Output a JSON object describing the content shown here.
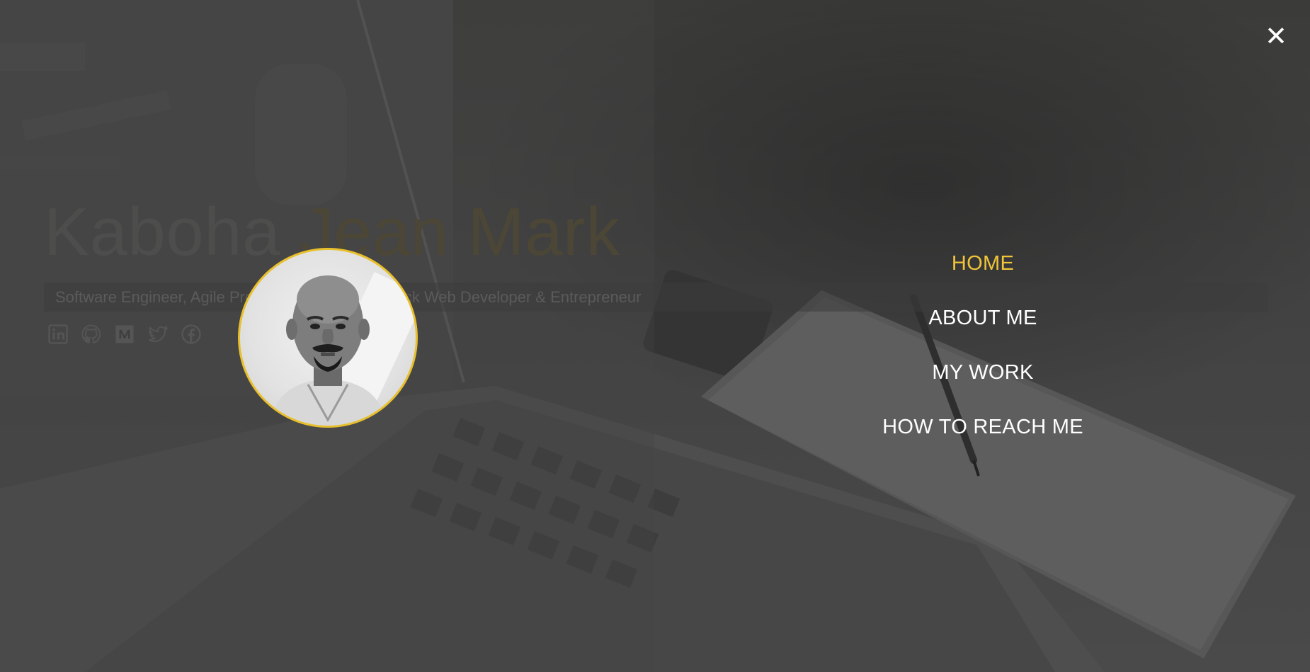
{
  "hero": {
    "first_name": "Kaboha",
    "last_name": "Jean Mark",
    "subtitle": "Software Engineer, Agile Project Manager, Full Stack Web Developer & Entrepreneur"
  },
  "socials": [
    {
      "icon": "linkedin-icon"
    },
    {
      "icon": "github-icon"
    },
    {
      "icon": "medium-icon"
    },
    {
      "icon": "twitter-icon"
    },
    {
      "icon": "facebook-icon"
    }
  ],
  "menu": {
    "close_icon": "close-icon",
    "close_glyph": "✕",
    "items": [
      {
        "label": "HOME",
        "active": true
      },
      {
        "label": "ABOUT ME",
        "active": false
      },
      {
        "label": "MY WORK",
        "active": false
      },
      {
        "label": "HOW TO REACH ME",
        "active": false
      }
    ]
  },
  "colors": {
    "accent": "#f0c43a",
    "menu_text": "#ffffff",
    "avatar_border": "#e8bf2c"
  }
}
